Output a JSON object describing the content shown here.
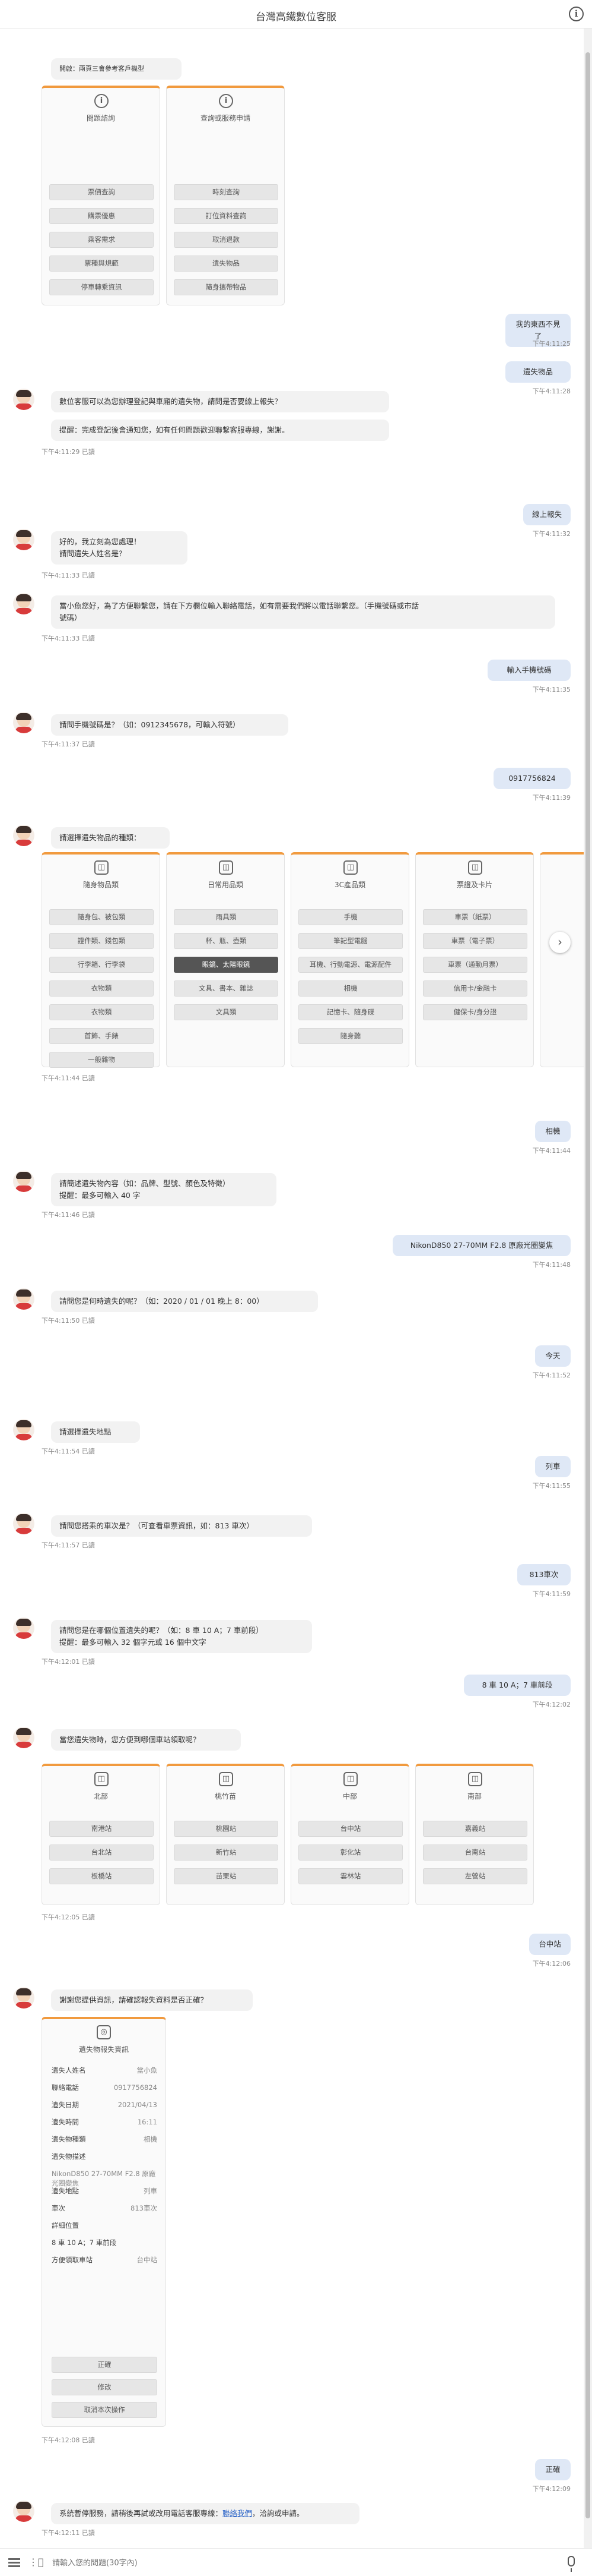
{
  "header": {
    "title": "台灣高鐵數位客服",
    "info_icon": "i"
  },
  "menu": {
    "prompt": "開啟：兩頁三會參考客戶機型",
    "cards": [
      {
        "icon": "info-icon",
        "title": "問題諮詢",
        "buttons": [
          "票價查詢",
          "購票優惠",
          "乘客需求",
          "票種與規範",
          "停車轉乘資訊"
        ]
      },
      {
        "icon": "info-icon",
        "title": "查詢或服務申請",
        "buttons": [
          "時刻查詢",
          "訂位資料查詢",
          "取消退款",
          "遺失物品",
          "隨身攜帶物品"
        ]
      }
    ]
  },
  "messages": {
    "u1": {
      "text": "我的東西不見了",
      "time": "下午4:11:25"
    },
    "u2": {
      "text": "遺失物品",
      "time": "下午4:11:28"
    },
    "b1": {
      "lines": [
        "數位客服可以為您辦理登記與車廂的遺失物，請問是否要線上報失？"
      ],
      "time": "下午4:11:29 已讀"
    },
    "b1b": {
      "lines": [
        "提醒：完成登記後會通知您，如有任何問題歡迎聯繫客服專線，謝謝。"
      ]
    },
    "u3": {
      "text": "線上報失",
      "time": "下午4:11:32"
    },
    "b2": {
      "lines": [
        "好的，我立刻為您處理！",
        "請問遺失人姓名是？"
      ],
      "time": "下午4:11:33 已讀"
    },
    "b3": {
      "lines": [
        "當小魚您好，為了方便聯繫您，請在下方欄位輸入聯絡電話，如有需要我們將以電話聯繫您。（手機號碼或市話",
        "號碼）"
      ],
      "time": "下午4:11:33 已讀"
    },
    "u4": {
      "text": "輸入手機號碼",
      "time": "下午4:11:35"
    },
    "b4": {
      "lines": [
        "請問手機號碼是？（如：0912345678，可輸入符號）"
      ],
      "time": "下午4:11:37 已讀"
    },
    "u5": {
      "text": "0917756824",
      "time": "下午4:11:39"
    },
    "b5": {
      "lines": [
        "請選擇遺失物品的種類："
      ],
      "time": "下午4:11:44 已讀"
    },
    "u6": {
      "text": "相機",
      "time": "下午4:11:44"
    },
    "b6": {
      "lines": [
        "請簡述遺失物內容（如：品牌、型號、顏色及特徵）",
        "提醒：最多可輸入 40 字"
      ],
      "time": "下午4:11:46 已讀"
    },
    "u7": {
      "text": "NikonD850 27-70MM F2.8 原廠光圈變焦",
      "time": "下午4:11:48"
    },
    "b7": {
      "lines": [
        "請問您是何時遺失的呢？（如：2020 / 01 / 01 晚上 8：00）"
      ],
      "time": "下午4:11:50 已讀"
    },
    "u8": {
      "text": "今天",
      "time": "下午4:11:52"
    },
    "b8": {
      "lines": [
        "請選擇遺失地點"
      ],
      "time": "下午4:11:54 已讀"
    },
    "u9": {
      "text": "列車",
      "time": "下午4:11:55"
    },
    "b9": {
      "lines": [
        "請問您搭乘的車次是？（可查看車票資訊，如：813 車次）"
      ],
      "time": "下午4:11:57 已讀"
    },
    "u10": {
      "text": "813車次",
      "time": "下午4:11:59"
    },
    "b10": {
      "lines": [
        "請問您是在哪個位置遺失的呢？（如：8 車 10 A；7 車前段）",
        "提醒：最多可輸入 32 個字元或 16 個中文字"
      ],
      "time": "下午4:12:01 已讀"
    },
    "u11": {
      "text": "8 車 10 A；7 車前段",
      "time": "下午4:12:02"
    },
    "b11": {
      "lines": [
        "當您遺失物時，您方便到哪個車站領取呢？"
      ],
      "time": "下午4:12:05 已讀"
    },
    "u12": {
      "text": "台中站",
      "time": "下午4:12:06"
    },
    "b12": {
      "lines": [
        "謝謝您提供資訊，請確認報失資料是否正確？"
      ],
      "time": "下午4:12:08 已讀"
    },
    "u13": {
      "text": "正確",
      "time": "下午4:12:09"
    },
    "b13": {
      "lines": [
        "系統暫停服務，請稍後再試或改用電話客服專線：",
        "聯絡我們",
        "，洽詢或申請。"
      ],
      "time": "下午4:12:11 已讀"
    }
  },
  "category": {
    "cards": [
      {
        "title": "隨身物品類",
        "buttons": [
          "隨身包、被包類",
          "證件類、錢包類",
          "行李箱、行李袋",
          "衣物類",
          "衣物類",
          "首飾、手錶",
          "一般雜物"
        ]
      },
      {
        "title": "日常用品類",
        "buttons": [
          "雨具類",
          "杯、瓶、壺類",
          "眼鏡、太陽眼鏡",
          "文具、書本、雜誌",
          "文具類"
        ]
      },
      {
        "title": "3C產品類",
        "buttons": [
          "手機",
          "筆記型電腦",
          "耳機、行動電源、電源配件",
          "相機",
          "記憶卡、隨身碟",
          "隨身聽"
        ]
      },
      {
        "title": "票證及卡片",
        "buttons": [
          "車票（紙票）",
          "車票（電子票）",
          "車票（通勤月票）",
          "信用卡/金融卡",
          "健保卡/身分證"
        ]
      }
    ]
  },
  "station": {
    "cards": [
      {
        "title": "北部",
        "buttons": [
          "南港站",
          "台北站",
          "板橋站"
        ]
      },
      {
        "title": "桃竹苗",
        "buttons": [
          "桃園站",
          "新竹站",
          "苗栗站"
        ]
      },
      {
        "title": "中部",
        "buttons": [
          "台中站",
          "彰化站",
          "雲林站"
        ]
      },
      {
        "title": "南部",
        "buttons": [
          "嘉義站",
          "台南站",
          "左營站"
        ]
      }
    ]
  },
  "summary": {
    "title": "遺失物報失資訊",
    "rows": [
      {
        "k": "遺失人姓名",
        "v": "當小魚"
      },
      {
        "k": "聯絡電話",
        "v": "0917756824"
      },
      {
        "k": "遺失日期",
        "v": "2021/04/13"
      },
      {
        "k": "遺失時間",
        "v": "16:11"
      },
      {
        "k": "遺失物種類",
        "v": "相機"
      },
      {
        "k": "遺失物描述",
        "v": ""
      },
      {
        "k": "",
        "v": "NikonD850 27-70MM F2.8 原廠光圈變焦"
      },
      {
        "k": "遺失地點",
        "v": "列車"
      },
      {
        "k": "車次",
        "v": "813車次"
      },
      {
        "k": "詳細位置",
        "v": ""
      },
      {
        "k": "8 車 10 A；7 車前段",
        "v": ""
      },
      {
        "k": "方便領取車站",
        "v": "台中站"
      }
    ],
    "buttons": [
      "正確",
      "修改",
      "取消本次操作"
    ]
  },
  "input": {
    "placeholder": "請輸入您的問題(30字內)"
  }
}
